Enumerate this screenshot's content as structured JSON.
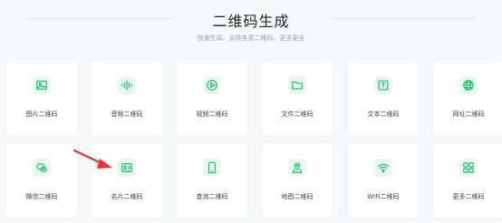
{
  "header": {
    "title": "二维码生成",
    "subtitle": "快速生成、支持各类二维码，更多更全"
  },
  "colors": {
    "accent": "#1fbf6e",
    "icon_bg": "#e8f7ef",
    "arrow": "#e8342e"
  },
  "cards": [
    {
      "label": "图片二维码",
      "icon": "image-icon"
    },
    {
      "label": "音频二维码",
      "icon": "audio-wave-icon"
    },
    {
      "label": "视频二维码",
      "icon": "play-circle-icon"
    },
    {
      "label": "文件二维码",
      "icon": "folder-icon"
    },
    {
      "label": "文本二维码",
      "icon": "text-t-icon"
    },
    {
      "label": "网址二维码",
      "icon": "globe-icon"
    },
    {
      "label": "微信二维码",
      "icon": "wechat-icon"
    },
    {
      "label": "名片二维码",
      "icon": "id-card-icon"
    },
    {
      "label": "查询二维码",
      "icon": "phone-icon"
    },
    {
      "label": "地图二维码",
      "icon": "map-pin-icon"
    },
    {
      "label": "WiFi二维码",
      "icon": "wifi-icon"
    },
    {
      "label": "更多二维码",
      "icon": "more-grid-icon"
    }
  ]
}
